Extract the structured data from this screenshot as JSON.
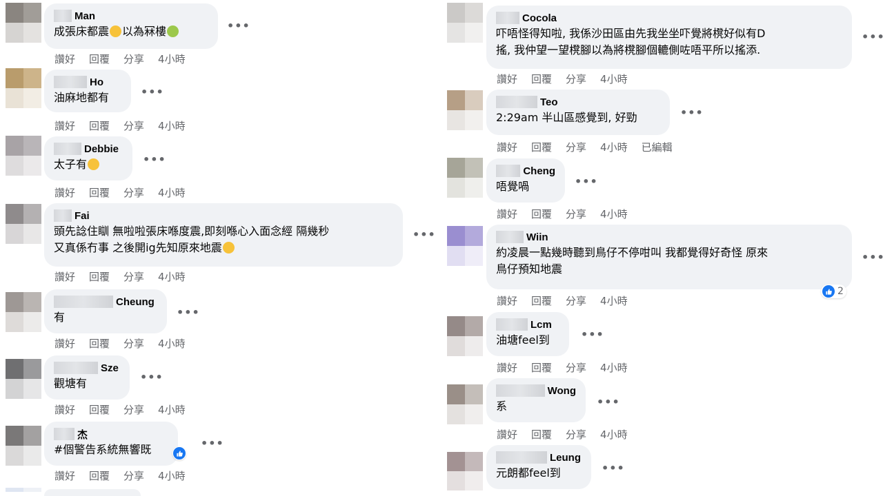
{
  "colors": {
    "bubble_bg": "#f0f2f5",
    "meta_text": "#65676b",
    "like_blue": "#1877f2"
  },
  "left_column": [
    {
      "name": "Man",
      "text": "成張床都震",
      "emojis_after": [
        "anxious-face-emoji",
        "nauseated-face-emoji"
      ],
      "text2": "以為冧樓",
      "actions": [
        "讚好",
        "回覆",
        "分享",
        "4小時"
      ]
    },
    {
      "name": "Ho",
      "text": "油麻地都有",
      "actions": [
        "讚好",
        "回覆",
        "分享",
        "4小時"
      ]
    },
    {
      "name": "Debbie",
      "text": "太子有",
      "emoji": "screaming-face-emoji",
      "actions": [
        "讚好",
        "回覆",
        "分享",
        "4小時"
      ]
    },
    {
      "name": "Fai",
      "text_line1": "頭先諗住瞓 無啦啦張床喺度震,即刻喺心入面念經 隔幾秒",
      "text_line2": "又真係冇事 之後開ig先知原來地震",
      "emoji": "grinning-sweat-emoji",
      "actions": [
        "讚好",
        "回覆",
        "分享",
        "4小時"
      ]
    },
    {
      "name": "Cheung",
      "text": "有",
      "actions": [
        "讚好",
        "回覆",
        "分享",
        "4小時"
      ]
    },
    {
      "name": "Sze",
      "text": "觀塘有",
      "actions": [
        "讚好",
        "回覆",
        "分享",
        "4小時"
      ]
    },
    {
      "name": "杰",
      "text": "#個警告系統無響既",
      "reaction": "like",
      "actions": [
        "讚好",
        "回覆",
        "分享",
        "4小時"
      ]
    }
  ],
  "right_column": [
    {
      "name": "Cocola",
      "text_line1": "吓唔怪得知啦, 我係沙田區由先我坐坐吓覺將櫈好似有D",
      "text_line2": "搖, 我仲望一望櫈腳以為將櫈腳個轆側咗唔平所以搖添.",
      "actions": [
        "讚好",
        "回覆",
        "分享",
        "4小時"
      ]
    },
    {
      "name": "Teo",
      "text": "2:29am 半山區感覺到, 好勁",
      "actions": [
        "讚好",
        "回覆",
        "分享",
        "4小時",
        "已編輯"
      ]
    },
    {
      "name": "Cheng",
      "name_prefix": "Van",
      "text": "唔覺喎",
      "actions": [
        "讚好",
        "回覆",
        "分享",
        "4小時"
      ]
    },
    {
      "name": "Wiin",
      "text_line1": "約凌晨一點幾時聽到鳥仔不停咁叫 我都覺得好奇怪 原來",
      "text_line2": "鳥仔預知地震",
      "reaction": "like",
      "reaction_count": "2",
      "actions": [
        "讚好",
        "回覆",
        "分享",
        "4小時"
      ]
    },
    {
      "name": "Lcm",
      "text": "油塘feel到",
      "actions": [
        "讚好",
        "回覆",
        "分享",
        "4小時"
      ]
    },
    {
      "name": "Wong",
      "text": "系",
      "actions": [
        "讚好",
        "回覆",
        "分享",
        "4小時"
      ]
    },
    {
      "name": "Leung",
      "name_prefix": "n",
      "text": "元朗都feel到",
      "actions": []
    }
  ],
  "more_label": "•••"
}
